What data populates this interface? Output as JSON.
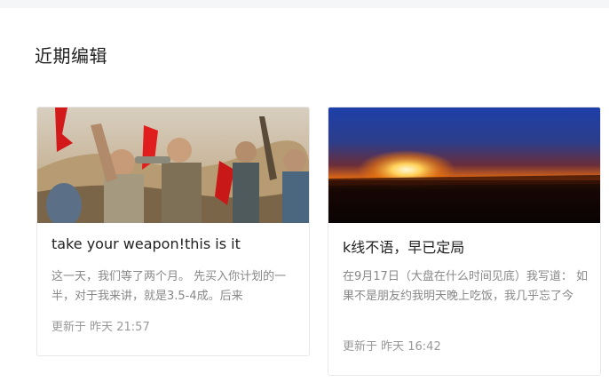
{
  "section": {
    "title": "近期编辑"
  },
  "cards": [
    {
      "title": "take your weapon!this is it",
      "excerpt": "这一天，我们等了两个月。 先买入你计划的一半，对于我来讲，就是3.5-4成。后来",
      "meta": "更新于 昨天 21:57",
      "image": "war-film-soldiers-photo"
    },
    {
      "title": "k线不语，早已定局",
      "excerpt": "在9月17日（大盘在什么时间见底）我写道： 如果不是朋友约我明天晚上吃饭，我几乎忘了今",
      "meta": "更新于 昨天 16:42",
      "image": "sunset-photo"
    }
  ],
  "colors": {
    "page_background": "#ffffff",
    "top_strip": "#f5f6f7",
    "card_border": "#e8e8e8",
    "title_text": "#222222",
    "excerpt_text": "#888888",
    "meta_text": "#999999"
  }
}
